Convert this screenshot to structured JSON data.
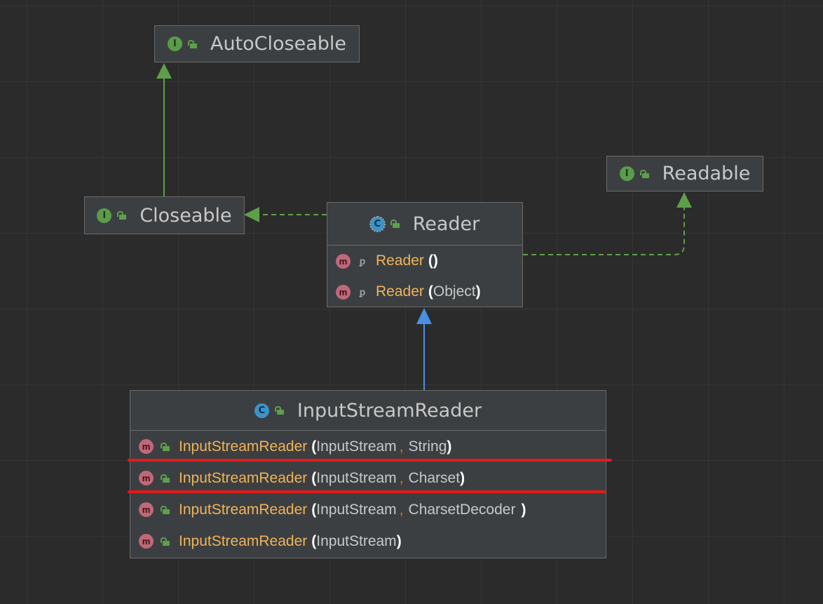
{
  "nodes": {
    "autocloseable": {
      "name": "AutoCloseable",
      "kind": "interface",
      "badge": "I"
    },
    "closeable": {
      "name": "Closeable",
      "kind": "interface",
      "badge": "I"
    },
    "readable": {
      "name": "Readable",
      "kind": "interface",
      "badge": "I"
    },
    "reader": {
      "name": "Reader",
      "kind": "abstract-class",
      "badge": "C",
      "methods": [
        {
          "badge": "m",
          "visibility": "protected",
          "name": "Reader",
          "open": "(",
          "params": [],
          "close": ")"
        },
        {
          "badge": "m",
          "visibility": "protected",
          "name": "Reader",
          "open": "(",
          "params": [
            "Object"
          ],
          "close": ")"
        }
      ]
    },
    "isr": {
      "name": "InputStreamReader",
      "kind": "class",
      "badge": "C",
      "methods": [
        {
          "badge": "m",
          "visibility": "public",
          "name": "InputStreamReader",
          "open": "(",
          "params": [
            "InputStream",
            "String"
          ],
          "close": ")"
        },
        {
          "badge": "m",
          "visibility": "public",
          "name": "InputStreamReader",
          "open": "(",
          "params": [
            "InputStream",
            "Charset"
          ],
          "close": ")"
        },
        {
          "badge": "m",
          "visibility": "public",
          "name": "InputStreamReader",
          "open": "(",
          "params": [
            "InputStream",
            "CharsetDecoder"
          ],
          "close": ")"
        },
        {
          "badge": "m",
          "visibility": "public",
          "name": "InputStreamReader",
          "open": "(",
          "params": [
            "InputStream"
          ],
          "close": ")"
        }
      ]
    }
  },
  "edges": [
    {
      "from": "Closeable",
      "to": "AutoCloseable",
      "type": "extends"
    },
    {
      "from": "Reader",
      "to": "Closeable",
      "type": "implements"
    },
    {
      "from": "Reader",
      "to": "Readable",
      "type": "implements"
    },
    {
      "from": "InputStreamReader",
      "to": "Reader",
      "type": "extends"
    }
  ],
  "highlight": {
    "color": "#e31b1b",
    "note": "red underlines mark the String and Charset constructors"
  },
  "colors": {
    "background": "#2b2b2b",
    "interface_edge": "#5f9e4a",
    "class_edge": "#4a90e2",
    "method_name": "#f0b35a"
  }
}
